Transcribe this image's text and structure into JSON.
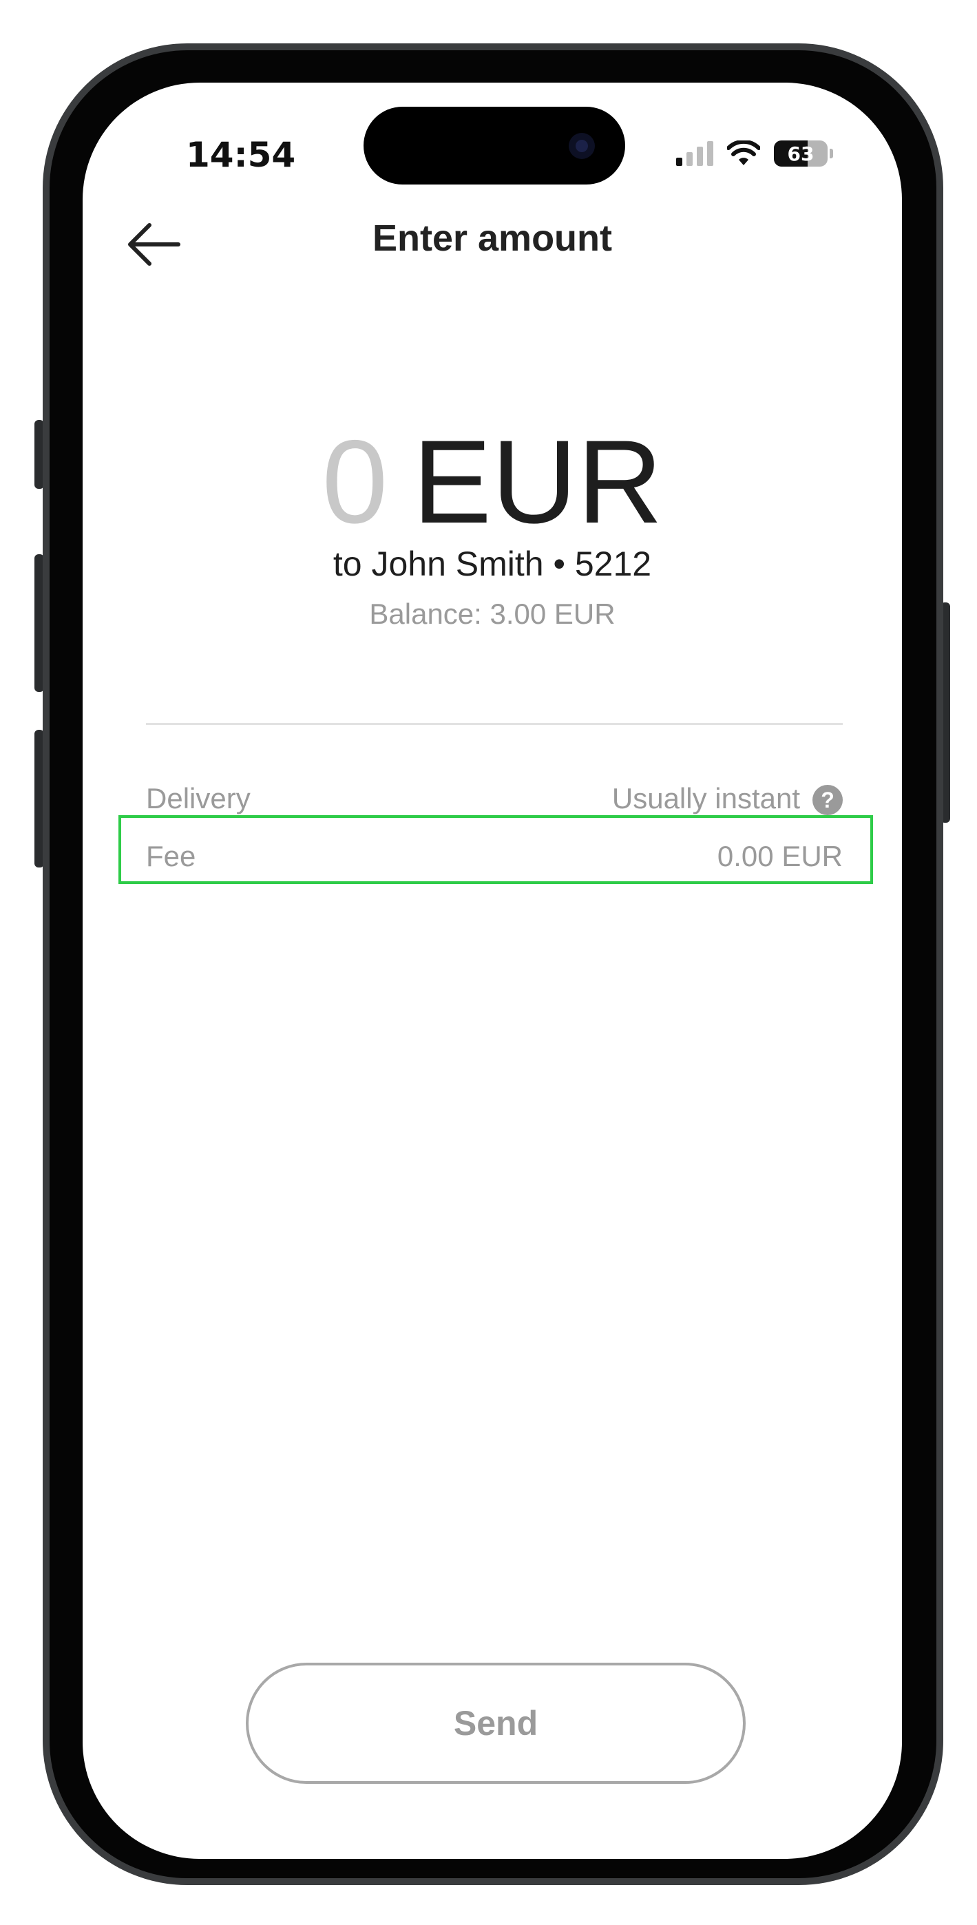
{
  "status_bar": {
    "time": "14:54",
    "battery_percent": "63",
    "battery_level": 0.63,
    "icons": [
      "signal-icon",
      "wifi-icon",
      "battery-icon"
    ]
  },
  "header": {
    "title": "Enter amount",
    "back_icon": "arrow-left-icon"
  },
  "amount": {
    "value": "0",
    "currency": "EUR"
  },
  "recipient": "to John Smith • 5212",
  "balance": "Balance: 3.00 EUR",
  "details": {
    "delivery": {
      "label": "Delivery",
      "value": "Usually instant",
      "help_icon": "question-icon"
    },
    "fee": {
      "label": "Fee",
      "value": "0.00 EUR"
    }
  },
  "send_button": {
    "label": "Send"
  },
  "colors": {
    "highlight": "#2ecc48",
    "muted_text": "#9a9a9a",
    "primary_text": "#1e1e1e"
  }
}
